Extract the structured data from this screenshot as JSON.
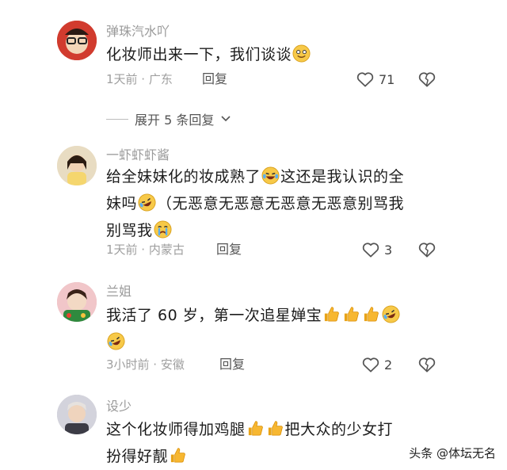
{
  "comments": [
    {
      "username": "弹珠汽水吖",
      "text_parts": [
        "化妆师出来一下，我们谈谈",
        ""
      ],
      "meta": "1天前 · 广东",
      "reply_label": "回复",
      "likes": "71",
      "avatar_color": "#c0392b"
    },
    {
      "username": "一虾虾虾酱",
      "line1": "给全妹妹化的妆成熟了",
      "line1b": "这还是我认识的全",
      "line2a": "妹吗",
      "line2b": "（无恶意无恶意无恶意无恶意别骂我",
      "line3": "别骂我",
      "meta": "1天前 · 内蒙古",
      "reply_label": "回复",
      "likes": "3",
      "avatar_color": "#e9d3b0"
    },
    {
      "username": "兰姐",
      "line1": "我活了 60 岁，第一次追星婵宝",
      "meta": "3小时前 · 安徽",
      "reply_label": "回复",
      "likes": "2",
      "avatar_color": "#d9a2a8"
    },
    {
      "username": "设少",
      "line1": "这个化妆师得加鸡腿",
      "line1b": "把大众的少女打",
      "line2": "扮得好靓",
      "avatar_color": "#b9b9c4"
    }
  ],
  "expand_replies": "展开 5 条回复",
  "watermark": "头条 @体坛无名",
  "icons": {
    "heart": "heart-outline-icon",
    "dislike": "broken-heart-icon",
    "chevron": "chevron-down-icon",
    "emoji_smile": "smiling-face-icon",
    "emoji_laugh": "tears-of-joy-icon",
    "emoji_rofl": "rolling-laughing-icon",
    "emoji_cry": "crying-face-icon",
    "emoji_thumb": "thumbs-up-icon"
  }
}
